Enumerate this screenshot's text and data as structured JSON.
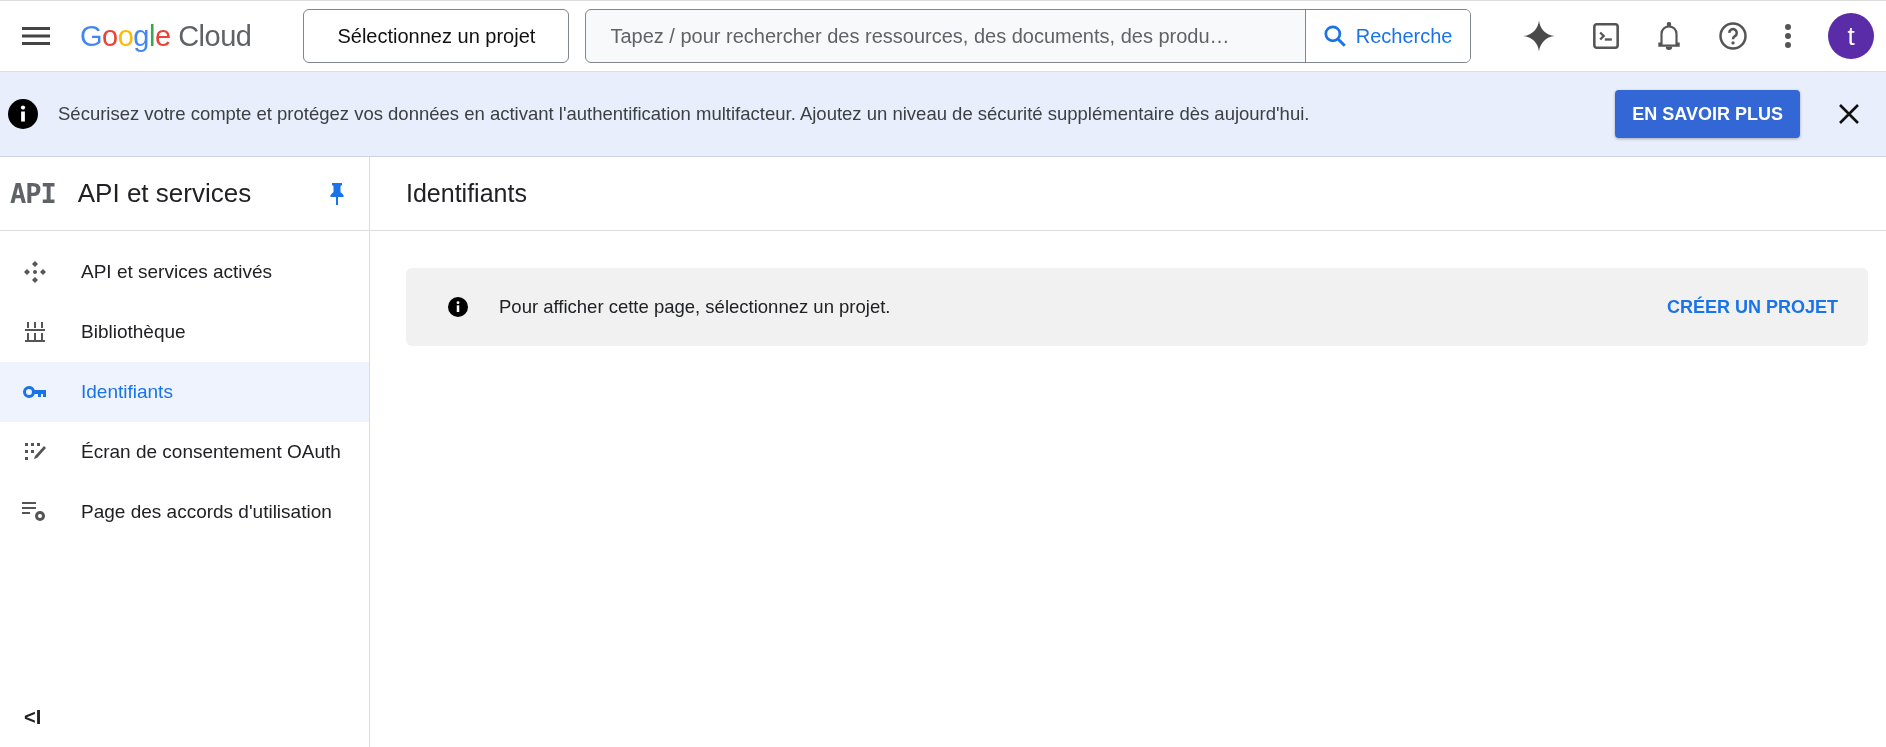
{
  "top_bar": {
    "logo": {
      "brand": "Google",
      "product": "Cloud"
    },
    "project_button": "Sélectionnez un projet",
    "search": {
      "placeholder": "Tapez / pour rechercher des ressources, des documents, des produ…",
      "button": "Recherche"
    },
    "avatar": "t"
  },
  "banner": {
    "text": "Sécurisez votre compte et protégez vos données en activant l'authentification multifacteur. Ajoutez un niveau de sécurité supplémentaire dès aujourd'hui.",
    "button": "EN SAVOIR PLUS"
  },
  "sidebar": {
    "badge": "API",
    "title": "API et services",
    "pinned": true,
    "items": [
      {
        "label": "API et services activés",
        "kind": "apis",
        "selected": false
      },
      {
        "label": "Bibliothèque",
        "kind": "library",
        "selected": false
      },
      {
        "label": "Identifiants",
        "kind": "key",
        "selected": true
      },
      {
        "label": "Écran de consentement OAuth",
        "kind": "consent",
        "selected": false
      },
      {
        "label": "Page des accords d'utilisation",
        "kind": "agreements",
        "selected": false
      }
    ],
    "collapse": "<I"
  },
  "page": {
    "title": "Identifiants",
    "notice": {
      "text": "Pour afficher cette page, sélectionnez un projet.",
      "action": "CRÉER UN PROJET"
    }
  }
}
